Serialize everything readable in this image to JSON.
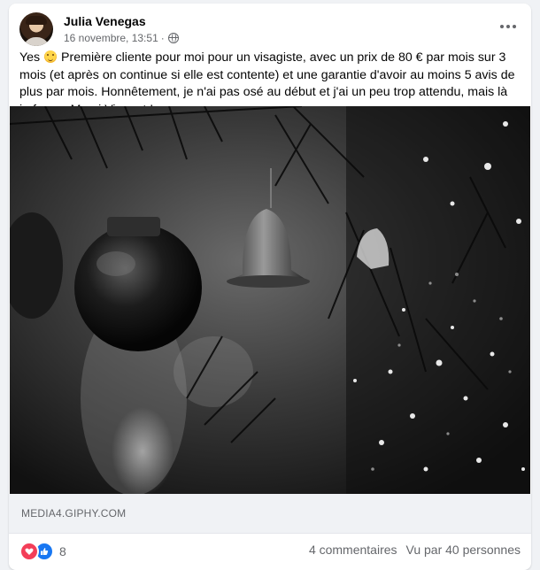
{
  "post": {
    "author": "Julia Venegas",
    "date": "16 novembre, 13:51",
    "separator": "·",
    "text_before_emoji": "Yes",
    "text_after_emoji": " Première cliente pour moi pour un visagiste, avec un prix de 80 € par mois sur 3 mois (et après on continue si elle est contente) et une garantie d'avoir au moins 5 avis de plus par mois. Honnêtement, je n'ai pas osé au début et j'ai un peu trop attendu, mais là je fonce. Merci Vincent !",
    "emoji": "grinning-face-icon",
    "privacy_icon": "globe-icon"
  },
  "media": {
    "type": "gif",
    "domain": "MEDIA4.GIPHY.COM"
  },
  "footer": {
    "reaction_icons": [
      "love-icon",
      "like-icon"
    ],
    "reaction_count": "8",
    "comments": "4 commentaires",
    "views": "Vu par 40 personnes"
  },
  "colors": {
    "background": "#f0f2f5",
    "card": "#ffffff",
    "secondary_text": "#65676b",
    "like_blue": "#1877f2",
    "love_red": "#f33e58"
  }
}
